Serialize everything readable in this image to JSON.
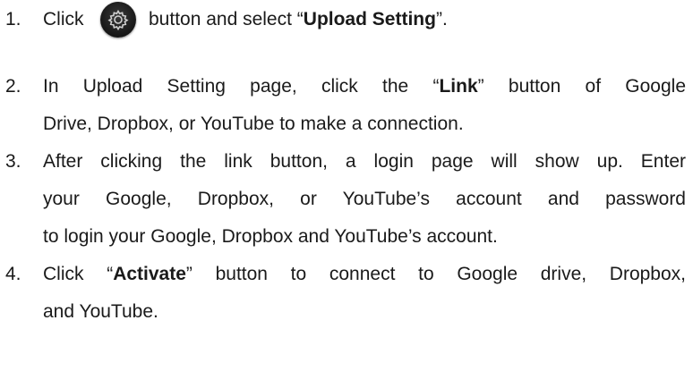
{
  "steps": [
    {
      "number": "1.",
      "click": "Click",
      "after_icon": "button and select “",
      "bold": "Upload Setting",
      "end": "”.",
      "icon": "gear-icon"
    },
    {
      "number": "2.",
      "line1_a": "In Upload Setting page, click the “",
      "line1_bold": "Link",
      "line1_b": "” button of Google",
      "line2": "Drive, Dropbox, or YouTube to make a connection."
    },
    {
      "number": "3.",
      "line1": "After clicking the link button, a login page will show up. Enter",
      "line2": "your Google, Dropbox, or YouTube’s account and password",
      "line3": "to login your Google, Dropbox and YouTube’s account."
    },
    {
      "number": "4.",
      "line1_a": "Click “",
      "line1_bold": "Activate",
      "line1_b": "” button to connect to Google drive, Dropbox,",
      "line2": "and YouTube."
    }
  ]
}
